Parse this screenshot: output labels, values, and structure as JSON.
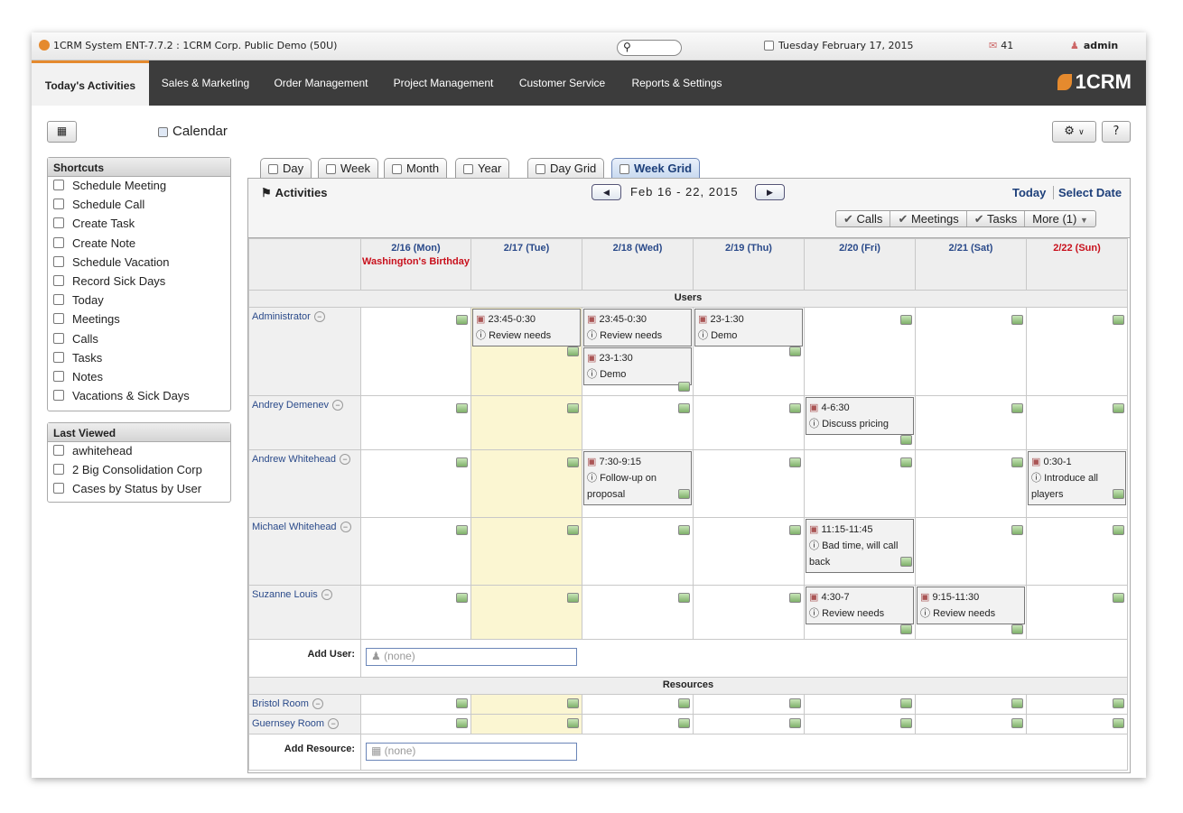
{
  "topbar": {
    "app_title": "1CRM System ENT-7.7.2 : 1CRM Corp. Public Demo (50U)",
    "search_icon": "search-icon",
    "date": "Tuesday February 17, 2015",
    "mail_count": "41",
    "user": "admin"
  },
  "nav": {
    "tabs": [
      "Today's Activities",
      "Sales & Marketing",
      "Order Management",
      "Project Management",
      "Customer Service",
      "Reports & Settings"
    ],
    "tab_colors": [
      "#e58a2e",
      "#e24b3a",
      "#5bb24a",
      "#4aa0d9",
      "#2a5ea8",
      "#d860a8"
    ],
    "brand": "1CRM"
  },
  "page": {
    "title": "Calendar"
  },
  "shortcuts": {
    "title": "Shortcuts",
    "items": [
      "Schedule Meeting",
      "Schedule Call",
      "Create Task",
      "Create Note",
      "Schedule Vacation",
      "Record Sick Days",
      "Today",
      "Meetings",
      "Calls",
      "Tasks",
      "Notes",
      "Vacations & Sick Days"
    ]
  },
  "last_viewed": {
    "title": "Last Viewed",
    "items": [
      "awhitehead",
      "2 Big Consolidation Corp",
      "Cases by Status by User"
    ]
  },
  "views": {
    "tabs": [
      "Day",
      "Week",
      "Month",
      "Year",
      "Day Grid",
      "Week Grid"
    ],
    "active": "Week Grid"
  },
  "calendar": {
    "section_label": "Activities",
    "range": "Feb 16 - 22, 2015",
    "today": "Today",
    "select_date": "Select Date",
    "filters": [
      "Calls",
      "Meetings",
      "Tasks",
      "More (1)"
    ],
    "days": [
      "2/16 (Mon)",
      "2/17 (Tue)",
      "2/18 (Wed)",
      "2/19 (Thu)",
      "2/20 (Fri)",
      "2/21 (Sat)",
      "2/22 (Sun)"
    ],
    "holiday": "Washington's Birthday",
    "users_label": "Users",
    "resources_label": "Resources",
    "add_user_label": "Add User:",
    "add_resource_label": "Add Resource:",
    "none_placeholder": "(none)",
    "users": [
      {
        "name": "Administrator",
        "events": [
          {
            "day": 1,
            "time": "23:45-0:30",
            "title": "Review needs"
          },
          {
            "day": 2,
            "time": "23:45-0:30",
            "title": "Review needs"
          },
          {
            "day": 2,
            "time": "23-1:30",
            "title": "Demo"
          },
          {
            "day": 3,
            "time": "23-1:30",
            "title": "Demo"
          }
        ]
      },
      {
        "name": "Andrey Demenev",
        "events": [
          {
            "day": 4,
            "time": "4-6:30",
            "title": "Discuss pricing"
          }
        ]
      },
      {
        "name": "Andrew Whitehead",
        "events": [
          {
            "day": 2,
            "time": "7:30-9:15",
            "title": "Follow-up on proposal"
          },
          {
            "day": 6,
            "time": "0:30-1",
            "title": "Introduce all players"
          }
        ]
      },
      {
        "name": "Michael Whitehead",
        "events": [
          {
            "day": 4,
            "time": "11:15-11:45",
            "title": "Bad time, will call back"
          }
        ]
      },
      {
        "name": "Suzanne Louis",
        "events": [
          {
            "day": 4,
            "time": "4:30-7",
            "title": "Review needs"
          },
          {
            "day": 5,
            "time": "9:15-11:30",
            "title": "Review needs"
          }
        ]
      }
    ],
    "resources": [
      "Bristol Room",
      "Guernsey Room"
    ]
  }
}
